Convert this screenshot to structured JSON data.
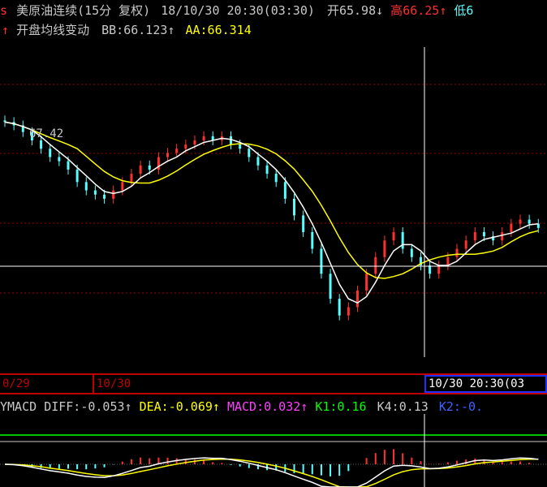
{
  "header": {
    "icon_text": "s",
    "symbol": "美原油连续(15分 复权)",
    "datetime": "18/10/30 20:30(03:30)",
    "open_label": "开",
    "open_value": "65.98",
    "open_arrow": "↓",
    "high_label": "高",
    "high_value": "66.25",
    "high_arrow": "↑",
    "low_label": "低6"
  },
  "indicator_line": {
    "arrow": "↑",
    "title": "开盘均线变动",
    "bb_label": "BB:",
    "bb_value": "66.123",
    "bb_arrow": "↑",
    "aa_label": "AA:",
    "aa_value": "66.314"
  },
  "price_label": "67.42",
  "time_axis": {
    "label_1": "0/29",
    "label_2": "10/30",
    "cursor_label": "10/30 20:30(03"
  },
  "macd_header": {
    "name": "YMACD",
    "diff_label": "DIFF:",
    "diff_value": "-0.053",
    "diff_arrow": "↑",
    "dea_label": "DEA:",
    "dea_value": "-0.069",
    "dea_arrow": "↑",
    "macd_label": "MACD:",
    "macd_value": "0.032",
    "macd_arrow": "↑",
    "k1_label": "K1:",
    "k1_value": "0.16",
    "k4_label": "K4:",
    "k4_value": "0.13",
    "k2_label": "K2:",
    "k2_value": "-0."
  },
  "colors": {
    "up": "#ff3030",
    "down": "#55ffff",
    "white_line": "#ffffff",
    "yellow_line": "#ffff00",
    "grid": "#a00000",
    "macd": "#ff40ff",
    "k1": "#00ff00",
    "k2": "#4060ff"
  },
  "chart_data": {
    "type": "candlestick",
    "bars_close": [
      67.42,
      67.38,
      67.3,
      67.2,
      67.1,
      67.0,
      66.95,
      66.85,
      66.7,
      66.6,
      66.55,
      66.5,
      66.6,
      66.7,
      66.8,
      66.9,
      66.85,
      67.0,
      67.05,
      67.1,
      67.15,
      67.2,
      67.25,
      67.2,
      67.25,
      67.15,
      67.1,
      67.0,
      66.9,
      66.8,
      66.7,
      66.5,
      66.3,
      66.1,
      65.9,
      65.6,
      65.3,
      65.1,
      65.2,
      65.4,
      65.6,
      65.8,
      66.0,
      66.1,
      65.9,
      65.8,
      65.7,
      65.6,
      65.7,
      65.8,
      65.9,
      66.0,
      66.1,
      66.05,
      66.0,
      66.1,
      66.2,
      66.25,
      66.2,
      66.15
    ]
  }
}
